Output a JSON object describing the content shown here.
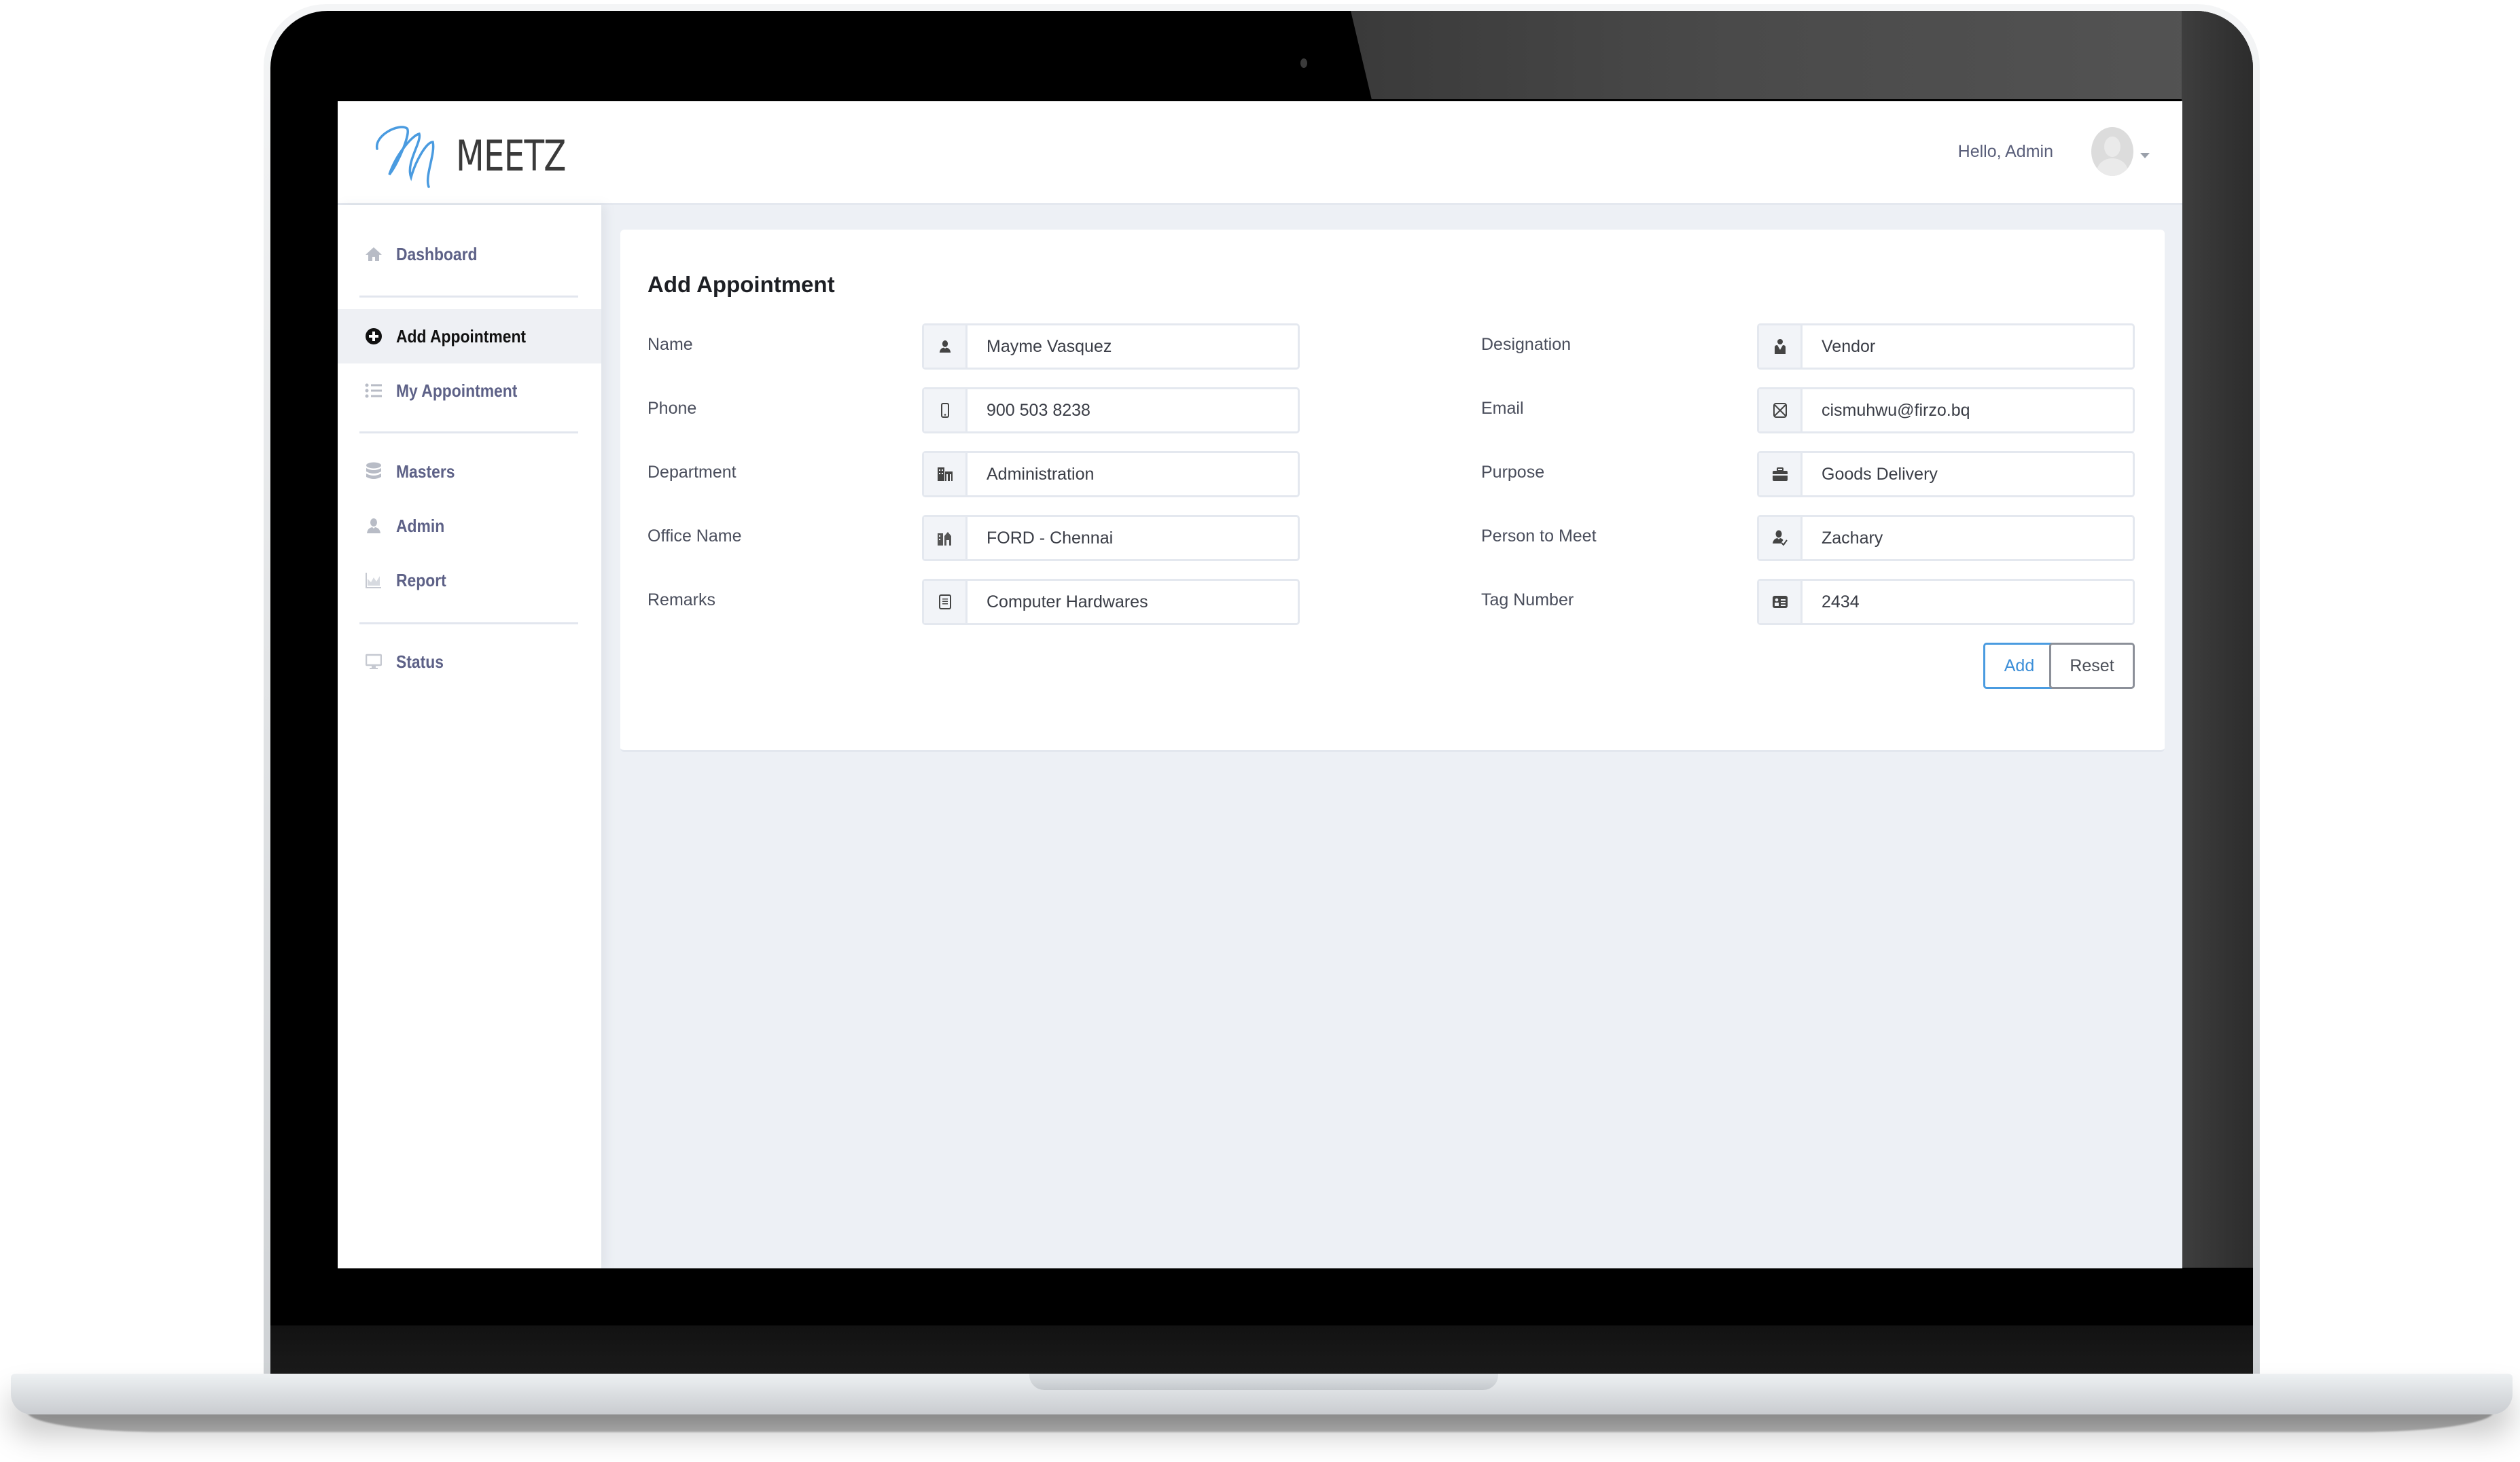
{
  "app": {
    "logo_mark": "M",
    "logo_text": "MEETZ",
    "brand_color": "#4a9be0"
  },
  "header": {
    "greeting": "Hello, Admin",
    "avatar_icon": "user-avatar-icon",
    "menu_icon": "caret-down-icon"
  },
  "sidebar": {
    "items": [
      {
        "label": "Dashboard",
        "icon": "home-icon",
        "active": false
      },
      {
        "label": "Add Appointment",
        "icon": "plus-circle-icon",
        "active": true
      },
      {
        "label": "My Appointment",
        "icon": "list-icon",
        "active": false
      },
      {
        "label": "Masters",
        "icon": "database-icon",
        "active": false
      },
      {
        "label": "Admin",
        "icon": "user-icon",
        "active": false
      },
      {
        "label": "Report",
        "icon": "chart-icon",
        "active": false
      },
      {
        "label": "Status",
        "icon": "monitor-icon",
        "active": false
      }
    ]
  },
  "form": {
    "title": "Add Appointment",
    "left_fields": [
      {
        "label": "Name",
        "value": "Mayme Vasquez",
        "icon": "user-icon"
      },
      {
        "label": "Phone",
        "value": "900 503 8238",
        "icon": "mobile-icon"
      },
      {
        "label": "Department",
        "value": "Administration",
        "icon": "building-icon"
      },
      {
        "label": "Office Name",
        "value": "FORD - Chennai",
        "icon": "office-icon"
      },
      {
        "label": "Remarks",
        "value": "Computer Hardwares",
        "icon": "note-icon"
      }
    ],
    "right_fields": [
      {
        "label": "Designation",
        "value": "Vendor",
        "icon": "employee-icon"
      },
      {
        "label": "Email",
        "value": "cismuhwu@firzo.bq",
        "icon": "mail-icon"
      },
      {
        "label": "Purpose",
        "value": "Goods Delivery",
        "icon": "briefcase-icon"
      },
      {
        "label": "Person to Meet",
        "value": "Zachary",
        "icon": "user-check-icon"
      },
      {
        "label": "Tag Number",
        "value": "2434",
        "icon": "id-card-icon"
      }
    ],
    "add_label": "Add",
    "reset_label": "Reset"
  }
}
